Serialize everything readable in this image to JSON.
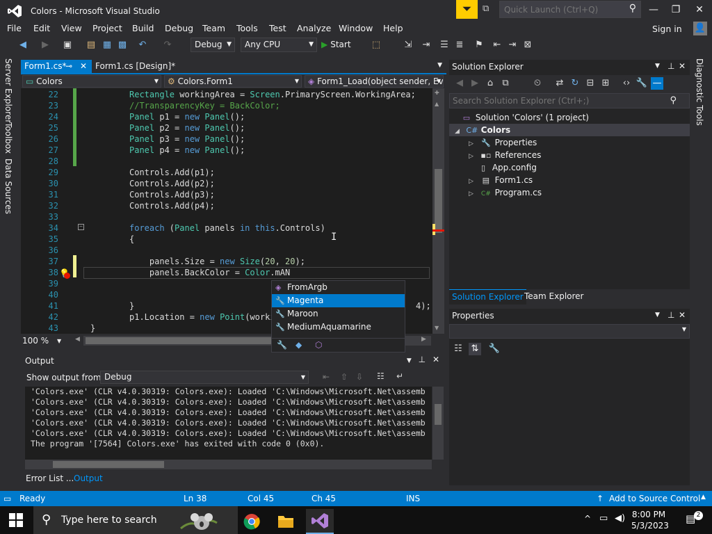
{
  "window": {
    "title": "Colors - Microsoft Visual Studio",
    "quick_launch_placeholder": "Quick Launch (Ctrl+Q)",
    "minimize": "—",
    "maximize": "❐",
    "close": "✕"
  },
  "menu": [
    "File",
    "Edit",
    "View",
    "Project",
    "Build",
    "Debug",
    "Team",
    "Tools",
    "Test",
    "Analyze",
    "Window",
    "Help"
  ],
  "signin": "Sign in",
  "toolbar": {
    "config": "Debug",
    "platform": "Any CPU",
    "start": "Start"
  },
  "left_tabs": [
    "Server Explorer",
    "Toolbox",
    "Data Sources"
  ],
  "right_tabs": [
    "Diagnostic Tools"
  ],
  "doc_tabs": [
    {
      "label": "Form1.cs*",
      "active": true
    },
    {
      "label": "Form1.cs [Design]*",
      "active": false
    }
  ],
  "navbar": {
    "project": "Colors",
    "class": "Colors.Form1",
    "member": "Form1_Load(object sender, Eve"
  },
  "code_lines": [
    {
      "n": "22",
      "html": "<span class='ty'>Rectangle</span> workingArea = <span class='ty'>Screen</span>.PrimaryScreen.WorkingArea;"
    },
    {
      "n": "23",
      "html": "<span class='cm'>//TransparencyKey = BackColor;</span>"
    },
    {
      "n": "24",
      "html": "<span class='ty'>Panel</span> p1 = <span class='kw'>new</span> <span class='ty'>Panel</span>();"
    },
    {
      "n": "25",
      "html": "<span class='ty'>Panel</span> p2 = <span class='kw'>new</span> <span class='ty'>Panel</span>();"
    },
    {
      "n": "26",
      "html": "<span class='ty'>Panel</span> p3 = <span class='kw'>new</span> <span class='ty'>Panel</span>();"
    },
    {
      "n": "27",
      "html": "<span class='ty'>Panel</span> p4 = <span class='kw'>new</span> <span class='ty'>Panel</span>();"
    },
    {
      "n": "28",
      "html": ""
    },
    {
      "n": "29",
      "html": "Controls.Add(p1);"
    },
    {
      "n": "30",
      "html": "Controls.Add(p2);"
    },
    {
      "n": "31",
      "html": "Controls.Add(p3);"
    },
    {
      "n": "32",
      "html": "Controls.Add(p4);"
    },
    {
      "n": "33",
      "html": ""
    },
    {
      "n": "34",
      "html": "<span class='kw'>foreach</span> (<span class='ty'>Panel</span> panels <span class='kw'>in</span> <span class='kw'>this</span>.Controls)"
    },
    {
      "n": "35",
      "html": "{"
    },
    {
      "n": "36",
      "html": ""
    },
    {
      "n": "37",
      "html": "    panels.Size = <span class='kw'>new</span> <span class='ty'>Size</span>(<span class='num'>20</span>, <span class='num'>20</span>);"
    },
    {
      "n": "38",
      "html": "    panels.BackColor = <span class='ty'>Color</span>.mAN"
    },
    {
      "n": "39",
      "html": ""
    },
    {
      "n": "40",
      "html": ""
    },
    {
      "n": "41",
      "html": "}"
    },
    {
      "n": "42",
      "html": "p1.Location = <span class='kw'>new</span> <span class='ty'>Point</span>(worki"
    },
    {
      "n": "43",
      "html": "}"
    }
  ],
  "code_tail_41": "4);",
  "zoom": "100 %",
  "autocomplete": {
    "items": [
      "FromArgb",
      "Magenta",
      "Maroon",
      "MediumAquamarine"
    ],
    "selected": "Magenta"
  },
  "output": {
    "title": "Output",
    "show_label": "Show output from:",
    "source": "Debug",
    "lines": [
      "'Colors.exe' (CLR v4.0.30319: Colors.exe): Loaded 'C:\\Windows\\Microsoft.Net\\assemb",
      "'Colors.exe' (CLR v4.0.30319: Colors.exe): Loaded 'C:\\Windows\\Microsoft.Net\\assemb",
      "'Colors.exe' (CLR v4.0.30319: Colors.exe): Loaded 'C:\\Windows\\Microsoft.Net\\assemb",
      "'Colors.exe' (CLR v4.0.30319: Colors.exe): Loaded 'C:\\Windows\\Microsoft.Net\\assemb",
      "'Colors.exe' (CLR v4.0.30319: Colors.exe): Loaded 'C:\\Windows\\Microsoft.Net\\assemb",
      "The program '[7564] Colors.exe' has exited with code 0 (0x0)."
    ]
  },
  "bottom_tabs": [
    "Error List ...",
    "Output"
  ],
  "solution_explorer": {
    "title": "Solution Explorer",
    "search_placeholder": "Search Solution Explorer (Ctrl+;)",
    "solution": "Solution 'Colors' (1 project)",
    "project": "Colors",
    "items": [
      "Properties",
      "References",
      "App.config",
      "Form1.cs",
      "Program.cs"
    ],
    "tab_se": "Solution Explorer",
    "tab_te": "Team Explorer"
  },
  "properties": {
    "title": "Properties"
  },
  "status": {
    "ready": "Ready",
    "ln": "Ln 38",
    "col": "Col 45",
    "ch": "Ch 45",
    "ins": "INS",
    "source_control": "Add to Source Control"
  },
  "taskbar": {
    "search": "Type here to search",
    "time": "8:00 PM",
    "date": "5/3/2023"
  },
  "colors": {
    "accent": "#007acc",
    "background": "#2d2d30",
    "editor": "#1e1e1e",
    "keyword": "#569cd6",
    "type": "#4ec9b0",
    "comment": "#57a64a"
  }
}
